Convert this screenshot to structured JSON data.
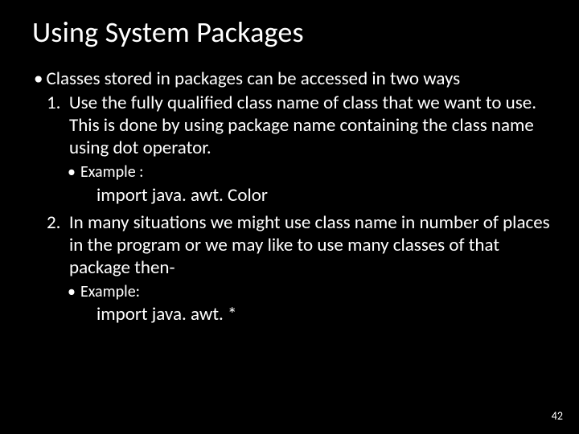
{
  "title": "Using System Packages",
  "intro": "Classes stored in packages can be accessed in two ways",
  "item1": {
    "num": "1.",
    "text": "Use the fully qualified class name of class that we want to use. This is done by using package name containing the class name using dot operator.",
    "example_label": "Example :",
    "code": "import java. awt. Color"
  },
  "item2": {
    "num": "2.",
    "text": "In many situations we might use class name in number of places in the program or we may like to use many classes of that package then-",
    "example_label": "Example:",
    "code": "import java. awt. *"
  },
  "page_number": "42"
}
